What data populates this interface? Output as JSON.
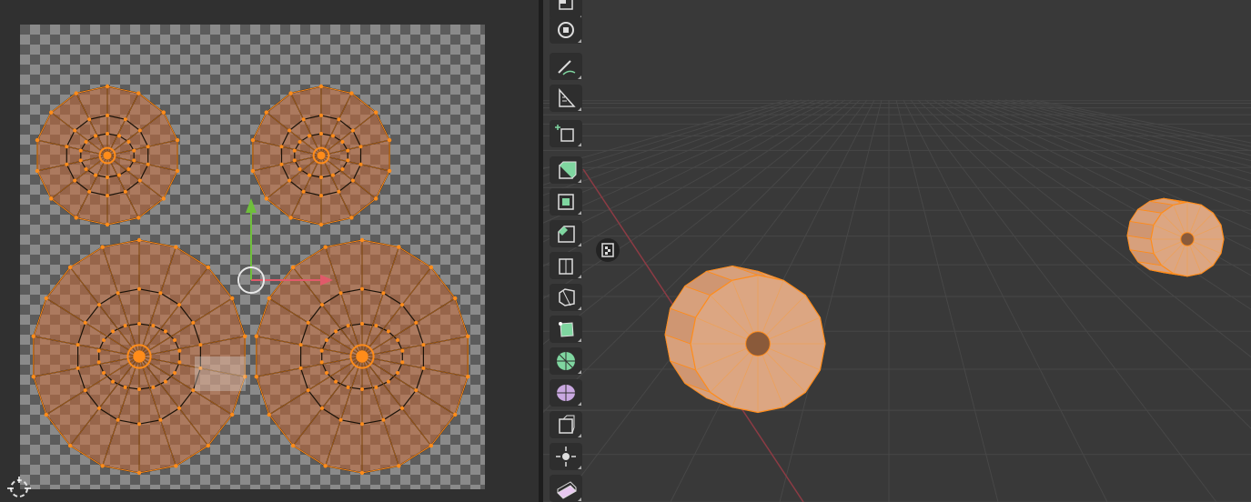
{
  "app": "Blender",
  "uv_editor": {
    "pivot_icon": "2d-cursor-icon",
    "gizmo": "move-gizmo",
    "texture": "checker-pattern",
    "islands": [
      "top-left-island",
      "top-right-island",
      "bottom-left-island",
      "bottom-right-island"
    ]
  },
  "viewport": {
    "overlay_button_icon": "transform-object-icon",
    "objects": [
      "near-cylinder-hub",
      "far-cylinder-hub"
    ],
    "colors": {
      "background": "#393939",
      "grid": "#4a4a4a",
      "x_axis": "#8c3b44",
      "selection": "#ff8c1a",
      "mesh": "#d9a07a"
    }
  },
  "toolbar": {
    "tools": [
      {
        "icon": "select-box-icon"
      },
      {
        "icon": "cursor-icon"
      },
      {
        "icon": "annotate-icon"
      },
      {
        "icon": "measure-icon"
      },
      {
        "icon": "add-cube-icon"
      },
      {
        "icon": "extrude-region-icon"
      },
      {
        "icon": "inset-faces-icon"
      },
      {
        "icon": "bevel-icon"
      },
      {
        "icon": "loop-cut-icon"
      },
      {
        "icon": "knife-icon"
      },
      {
        "icon": "poly-build-icon"
      },
      {
        "icon": "spin-icon"
      },
      {
        "icon": "smooth-icon"
      },
      {
        "icon": "edge-slide-icon"
      },
      {
        "icon": "shrink-fatten-icon"
      },
      {
        "icon": "shear-icon"
      }
    ]
  }
}
